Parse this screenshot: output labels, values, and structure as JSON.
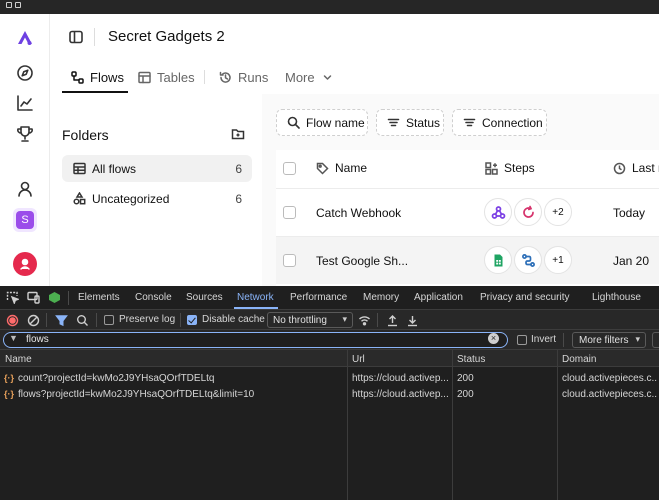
{
  "app": {
    "project_title": "Secret Gadgets 2"
  },
  "rail": {
    "workspace_avatar_letter": "S"
  },
  "tabs": [
    {
      "label": "Flows",
      "icon": "flow-icon",
      "active": true
    },
    {
      "label": "Tables",
      "icon": "table-icon",
      "active": false
    },
    {
      "label": "Runs",
      "icon": "history-icon",
      "active": false
    },
    {
      "label": "More",
      "icon": "chevron-down-icon",
      "active": false
    }
  ],
  "folders": {
    "title": "Folders",
    "items": [
      {
        "label": "All flows",
        "count": "6",
        "icon": "table-icon"
      },
      {
        "label": "Uncategorized",
        "count": "6",
        "icon": "shapes-icon"
      }
    ]
  },
  "filters": [
    {
      "label": "Flow name",
      "icon": "search-icon"
    },
    {
      "label": "Status",
      "icon": "filter-icon"
    },
    {
      "label": "Connection",
      "icon": "filter-icon"
    }
  ],
  "table": {
    "columns": {
      "name": "Name",
      "steps": "Steps",
      "last": "Last m"
    },
    "rows": [
      {
        "name": "Catch Webhook",
        "steps": [
          "webhook-icon",
          "loop-icon"
        ],
        "extra_steps": "+2",
        "date": "Today"
      },
      {
        "name": "Test Google Sh...",
        "steps": [
          "google-sheets-icon",
          "branch-icon"
        ],
        "extra_steps": "+1",
        "date": "Jan 20"
      }
    ]
  },
  "devtools": {
    "tabs": [
      "Elements",
      "Console",
      "Sources",
      "Network",
      "Performance",
      "Memory",
      "Application",
      "Privacy and security",
      "Lighthouse"
    ],
    "active_tab": "Network",
    "toolbar": {
      "preserve_log": "Preserve log",
      "disable_cache": "Disable cache",
      "throttling": "No throttling"
    },
    "filter": {
      "value": "flows",
      "invert": "Invert",
      "more_filters": "More filters"
    },
    "columns": {
      "name": "Name",
      "url": "Url",
      "status": "Status",
      "domain": "Domain"
    },
    "requests": [
      {
        "name": "count?projectId=kwMo2J9YHsaQOrfTDELtq",
        "url": "https://cloud.activep...",
        "status": "200",
        "domain": "cloud.activepieces.c..."
      },
      {
        "name": "flows?projectId=kwMo2J9YHsaQOrfTDELtq&limit=10",
        "url": "https://cloud.activep...",
        "status": "200",
        "domain": "cloud.activepieces.c..."
      }
    ]
  },
  "colors": {
    "brand": "#6e41e2",
    "devtools_accent": "#8ab4f8",
    "devtools_bg": "#282828"
  }
}
